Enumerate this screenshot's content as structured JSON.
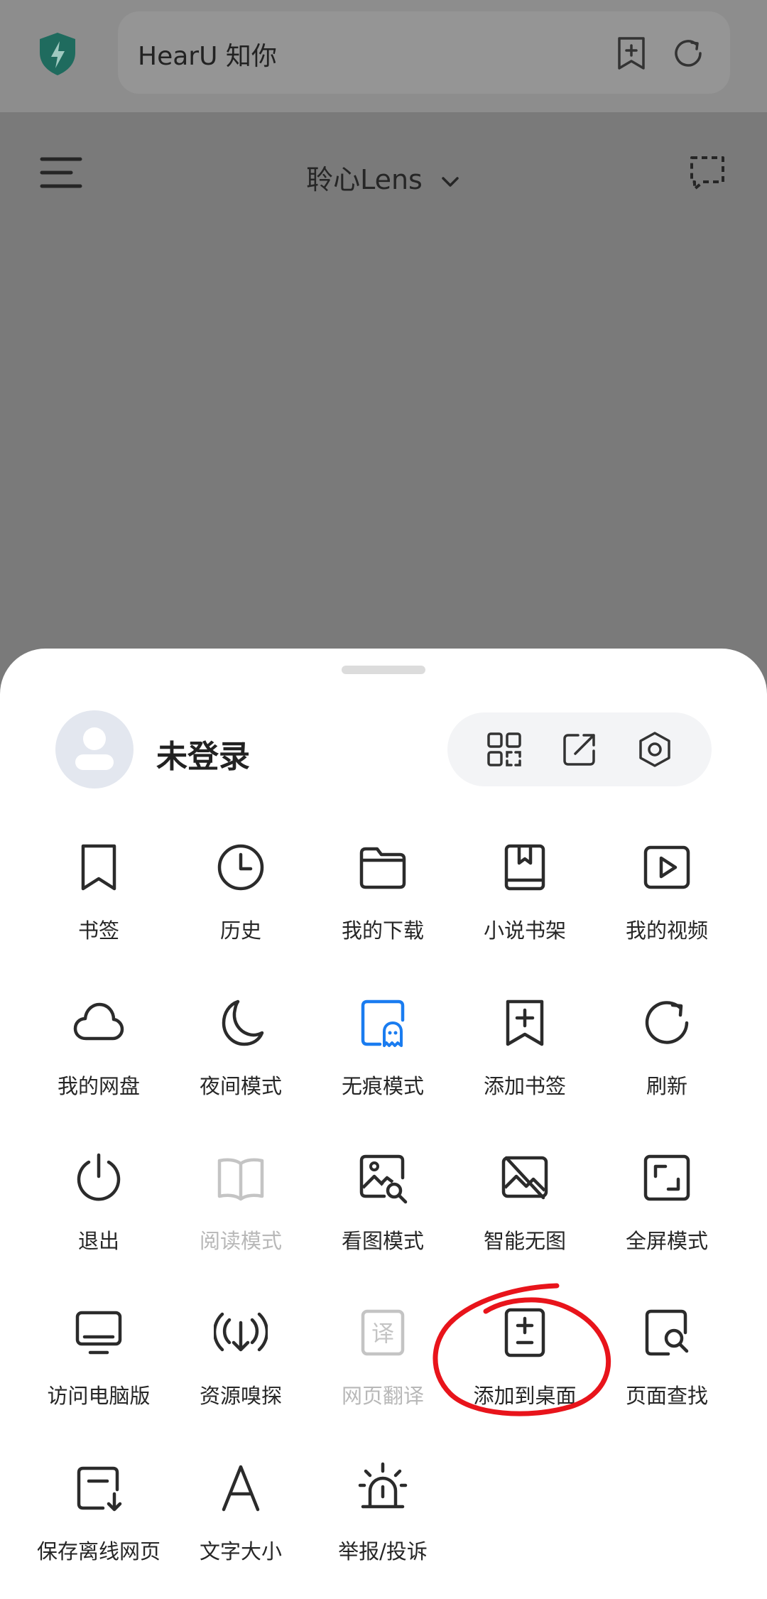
{
  "browser": {
    "url_title": "HearU 知你",
    "page_title": "聆心Lens"
  },
  "account": {
    "login_status": "未登录"
  },
  "menu": {
    "items": [
      {
        "label": "书签",
        "icon": "bookmark-icon",
        "enabled": true
      },
      {
        "label": "历史",
        "icon": "clock-icon",
        "enabled": true
      },
      {
        "label": "我的下载",
        "icon": "folder-icon",
        "enabled": true
      },
      {
        "label": "小说书架",
        "icon": "book-shelf-icon",
        "enabled": true
      },
      {
        "label": "我的视频",
        "icon": "play-icon",
        "enabled": true
      },
      {
        "label": "我的网盘",
        "icon": "cloud-icon",
        "enabled": true
      },
      {
        "label": "夜间模式",
        "icon": "moon-icon",
        "enabled": true
      },
      {
        "label": "无痕模式",
        "icon": "ghost-icon",
        "enabled": true,
        "active": true
      },
      {
        "label": "添加书签",
        "icon": "add-bookmark-icon",
        "enabled": true
      },
      {
        "label": "刷新",
        "icon": "refresh-icon",
        "enabled": true
      },
      {
        "label": "退出",
        "icon": "power-icon",
        "enabled": true
      },
      {
        "label": "阅读模式",
        "icon": "open-book-icon",
        "enabled": false
      },
      {
        "label": "看图模式",
        "icon": "image-search-icon",
        "enabled": true
      },
      {
        "label": "智能无图",
        "icon": "no-image-icon",
        "enabled": true
      },
      {
        "label": "全屏模式",
        "icon": "fullscreen-icon",
        "enabled": true
      },
      {
        "label": "访问电脑版",
        "icon": "monitor-icon",
        "enabled": true
      },
      {
        "label": "资源嗅探",
        "icon": "signal-download-icon",
        "enabled": true
      },
      {
        "label": "网页翻译",
        "icon": "translate-icon",
        "enabled": false
      },
      {
        "label": "添加到桌面",
        "icon": "add-to-desktop-icon",
        "enabled": true,
        "annotated": true
      },
      {
        "label": "页面查找",
        "icon": "page-search-icon",
        "enabled": true
      },
      {
        "label": "保存离线网页",
        "icon": "save-offline-icon",
        "enabled": true
      },
      {
        "label": "文字大小",
        "icon": "font-size-icon",
        "enabled": true
      },
      {
        "label": "举报/投诉",
        "icon": "alarm-icon",
        "enabled": true
      }
    ],
    "translate_glyph": "译"
  },
  "colors": {
    "accent_blue": "#1a7cf0",
    "annotation_red": "#e8141b",
    "shield_green": "#1f7f6e"
  }
}
